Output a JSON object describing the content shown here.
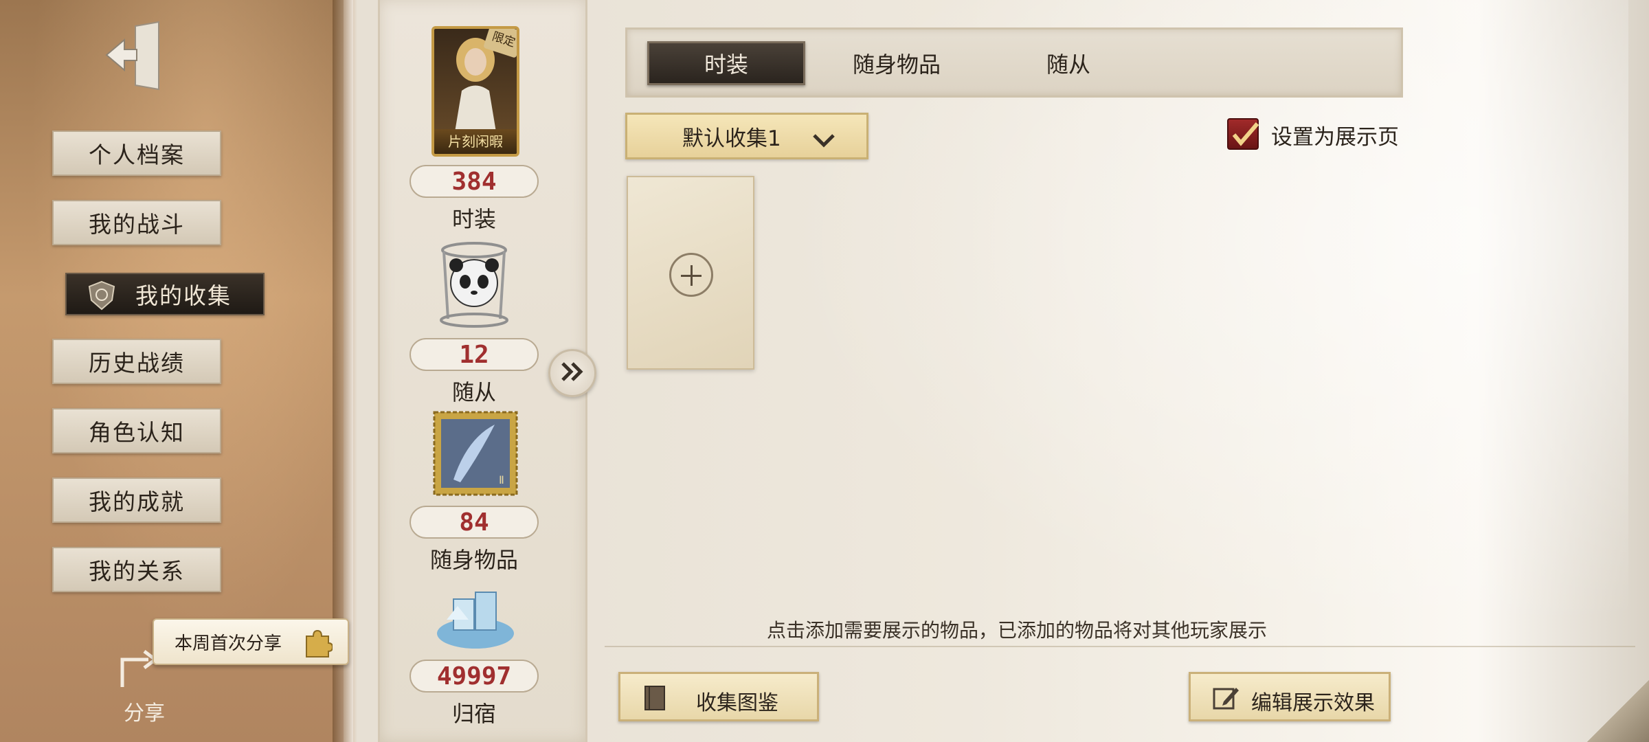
{
  "sidebar": {
    "items": [
      {
        "label": "个人档案"
      },
      {
        "label": "我的战斗"
      },
      {
        "label": "我的收集"
      },
      {
        "label": "历史战绩"
      },
      {
        "label": "角色认知"
      },
      {
        "label": "我的成就"
      },
      {
        "label": "我的关系"
      }
    ],
    "active_index": 2,
    "share_tag": "本周首次分享",
    "share_label": "分享"
  },
  "stats": {
    "costume": {
      "card_name": "片刻闲暇",
      "card_badge": "限定",
      "count": "384",
      "label": "时装"
    },
    "follower": {
      "count": "12",
      "label": "随从"
    },
    "accessory": {
      "count": "84",
      "label": "随身物品"
    },
    "home": {
      "count": "49997",
      "label": "归宿"
    }
  },
  "main": {
    "tabs": [
      {
        "label": "时装",
        "active": true
      },
      {
        "label": "随身物品",
        "active": false
      },
      {
        "label": "随从",
        "active": false
      }
    ],
    "dropdown_value": "默认收集1",
    "showcase_checkbox": {
      "label": "设置为展示页",
      "checked": true
    },
    "hint": "点击添加需要展示的物品，已添加的物品将对其他玩家展示",
    "buttons": {
      "collection_guide": "收集图鉴",
      "edit_display": "编辑展示效果"
    }
  },
  "colors": {
    "accent_red": "#a02f2f",
    "active_dark": "#2a241e",
    "gold": "#e7d19a"
  }
}
